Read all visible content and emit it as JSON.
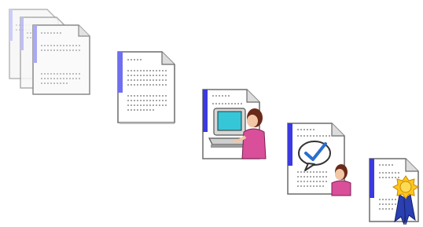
{
  "diagram": {
    "type": "process-flow",
    "direction": "diagonal-down-right",
    "steps": [
      {
        "icon": "document-stack-icon"
      },
      {
        "icon": "document-icon"
      },
      {
        "icon": "document-computer-user-icon"
      },
      {
        "icon": "document-review-check-icon"
      },
      {
        "icon": "certificate-award-icon"
      }
    ]
  },
  "colors": {
    "paper": "#ffffff",
    "paper_shade": "#d9d9d9",
    "outline": "#6b6b6b",
    "spine": "#6f6ff0",
    "spine_light": "#aaaaf6",
    "monitor_screen": "#35c6d8",
    "monitor_frame": "#d8d8d8",
    "person_skin": "#f2c7a5",
    "person_hair": "#6a2a1a",
    "person_shirt": "#d94f9a",
    "checkmark": "#2a6fd0",
    "award_gold": "#ffc61a",
    "award_ribbon": "#2a3fb0"
  }
}
